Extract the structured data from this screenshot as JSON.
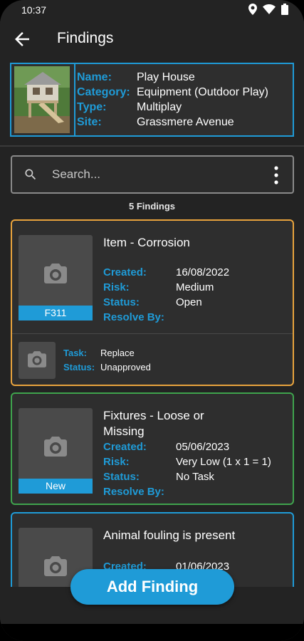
{
  "status_bar": {
    "time": "10:37"
  },
  "app_bar": {
    "title": "Findings"
  },
  "asset": {
    "rows": [
      {
        "label": "Name:",
        "value": "Play House"
      },
      {
        "label": "Category:",
        "value": "Equipment (Outdoor Play)"
      },
      {
        "label": "Type:",
        "value": "Multiplay"
      },
      {
        "label": "Site:",
        "value": "Grassmere Avenue"
      }
    ]
  },
  "search": {
    "placeholder": "Search..."
  },
  "findings_count": "5 Findings",
  "findings": [
    {
      "title": "Item - Corrosion",
      "tag": "F311",
      "border_color": "#e8a33d",
      "fields": [
        {
          "label": "Created:",
          "value": "16/08/2022"
        },
        {
          "label": "Risk:",
          "value": "Medium"
        },
        {
          "label": "Status:",
          "value": "Open"
        },
        {
          "label": "Resolve By:",
          "value": ""
        }
      ],
      "task": [
        {
          "label": "Task:",
          "value": "Replace"
        },
        {
          "label": "Status:",
          "value": "Unapproved"
        }
      ]
    },
    {
      "title": "Fixtures - Loose or Missing",
      "tag": "New",
      "border_color": "#3fa34d",
      "fields": [
        {
          "label": "Created:",
          "value": "05/06/2023"
        },
        {
          "label": "Risk:",
          "value": "Very Low (1 x 1 = 1)"
        },
        {
          "label": "Status:",
          "value": "No Task"
        },
        {
          "label": "Resolve By:",
          "value": ""
        }
      ]
    },
    {
      "title": "Animal fouling is present",
      "border_color": "#1f9bd7",
      "fields": [
        {
          "label": "Created:",
          "value": "01/06/2023"
        }
      ]
    }
  ],
  "fab": {
    "label": "Add Finding"
  },
  "colors": {
    "accent": "#1f9bd7",
    "background": "#232323",
    "card": "#2e2e2e"
  },
  "icons": [
    "back-arrow-icon",
    "search-icon",
    "more-vert-icon",
    "camera-icon",
    "location-icon",
    "wifi-icon",
    "battery-icon"
  ]
}
